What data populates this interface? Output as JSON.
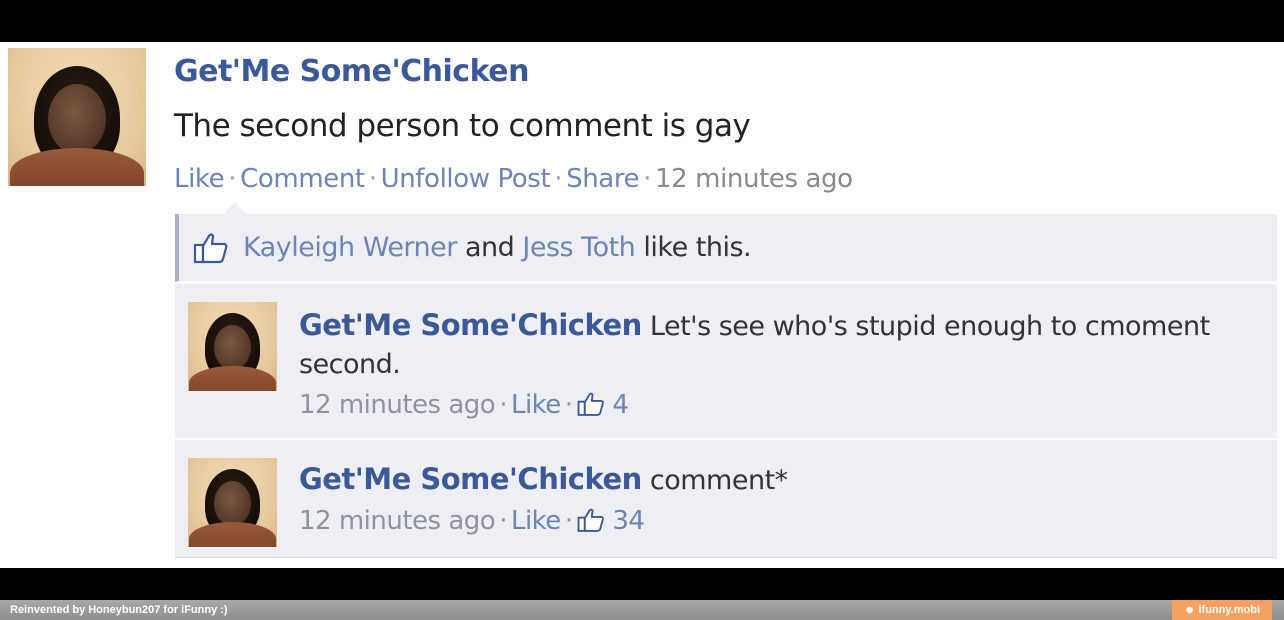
{
  "post": {
    "author": "Get'Me Some'Chicken",
    "text": "The second person to comment is gay",
    "actions": {
      "like": "Like",
      "comment": "Comment",
      "unfollow": "Unfollow Post",
      "share": "Share",
      "time": "12 minutes ago"
    },
    "likes": {
      "person1": "Kayleigh Werner",
      "joiner": "and",
      "person2": "Jess Toth",
      "suffix": "like this."
    }
  },
  "comments": [
    {
      "author": "Get'Me Some'Chicken",
      "text": "Let's see who's stupid enough to cmoment second.",
      "time": "12 minutes ago",
      "like_label": "Like",
      "like_count": "4"
    },
    {
      "author": "Get'Me Some'Chicken",
      "text": "comment*",
      "time": "12 minutes ago",
      "like_label": "Like",
      "like_count": "34"
    }
  ],
  "footer": {
    "credit": "Reinvented by Honeybun207 for iFunny :)",
    "brand": "☻ ifunny.mobi"
  },
  "colors": {
    "link_blue": "#3b5998",
    "action_blue": "#6d84b4",
    "comment_bg": "#edeff4"
  }
}
